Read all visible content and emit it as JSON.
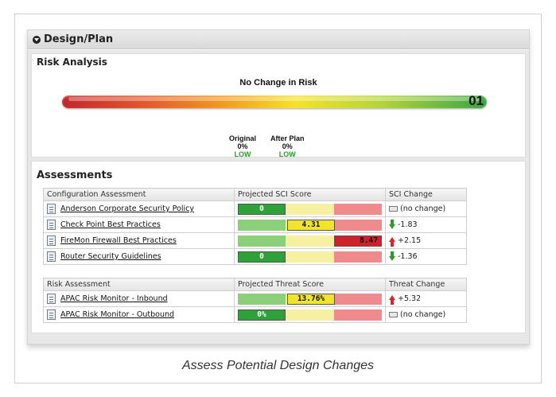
{
  "panel": {
    "title": "Design/Plan"
  },
  "risk": {
    "title": "Risk Analysis",
    "heading": "No Change in Risk",
    "gauge_value": "01",
    "original": {
      "label": "Original",
      "percent": "0%",
      "level": "LOW"
    },
    "after_plan": {
      "label": "After Plan",
      "percent": "0%",
      "level": "LOW"
    },
    "gauge_colors": [
      "#c1272d",
      "#f39a21",
      "#f5e12a",
      "#3aa640"
    ]
  },
  "assessments": {
    "title": "Assessments",
    "config": {
      "headers": [
        "Configuration Assessment",
        "Projected SCI Score",
        "SCI Change"
      ],
      "rows": [
        {
          "name": "Anderson Corporate Security Policy",
          "score": "0",
          "band": "green",
          "change": "(no change)",
          "direction": "none"
        },
        {
          "name": "Check Point Best Practices",
          "score": "4.31",
          "band": "yellow",
          "change": "-1.83",
          "direction": "down"
        },
        {
          "name": "FireMon Firewall Best Practices",
          "score": "8.47",
          "band": "red",
          "change": "+2.15",
          "direction": "up"
        },
        {
          "name": "Router Security Guidelines",
          "score": "0",
          "band": "green",
          "change": "-1.36",
          "direction": "down"
        }
      ]
    },
    "risk": {
      "headers": [
        "Risk Assessment",
        "Projected Threat Score",
        "Threat Change"
      ],
      "rows": [
        {
          "name": "APAC Risk Monitor - Inbound",
          "score": "13.76%",
          "band": "yellow",
          "change": "+5.32",
          "direction": "up"
        },
        {
          "name": "APAC Risk Monitor - Outbound",
          "score": "0%",
          "band": "green",
          "change": "(no change)",
          "direction": "none"
        }
      ]
    }
  },
  "caption": "Assess Potential Design Changes",
  "colors": {
    "low": "#2e9b2e",
    "band_green": "#2ea238",
    "band_yellow": "#f2e32d",
    "band_red": "#d0202a"
  }
}
